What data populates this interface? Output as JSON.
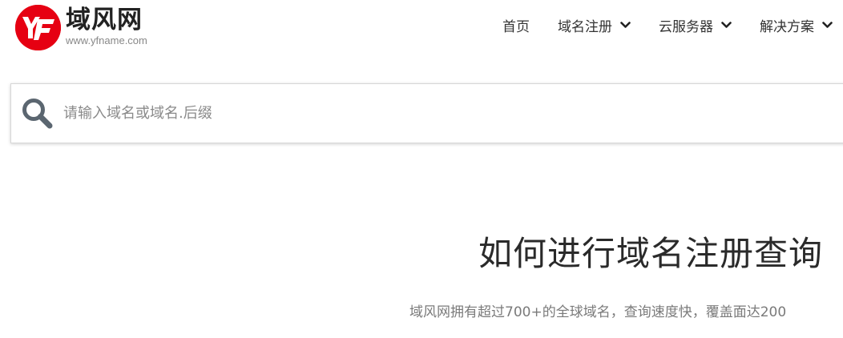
{
  "brand": {
    "badge_text": "YF",
    "name": "域风网",
    "url": "www.yfname.com",
    "color": "#e60012"
  },
  "nav": {
    "items": [
      {
        "label": "首页",
        "has_dropdown": false
      },
      {
        "label": "域名注册",
        "has_dropdown": true
      },
      {
        "label": "云服务器",
        "has_dropdown": true
      },
      {
        "label": "解决方案",
        "has_dropdown": true
      }
    ]
  },
  "search": {
    "placeholder": "请输入域名或域名.后缀",
    "value": "",
    "icon": "search-icon"
  },
  "hero": {
    "title": "如何进行域名注册查询",
    "subtitle": "域风网拥有超过700+的全球域名，查询速度快，覆盖面达200"
  }
}
